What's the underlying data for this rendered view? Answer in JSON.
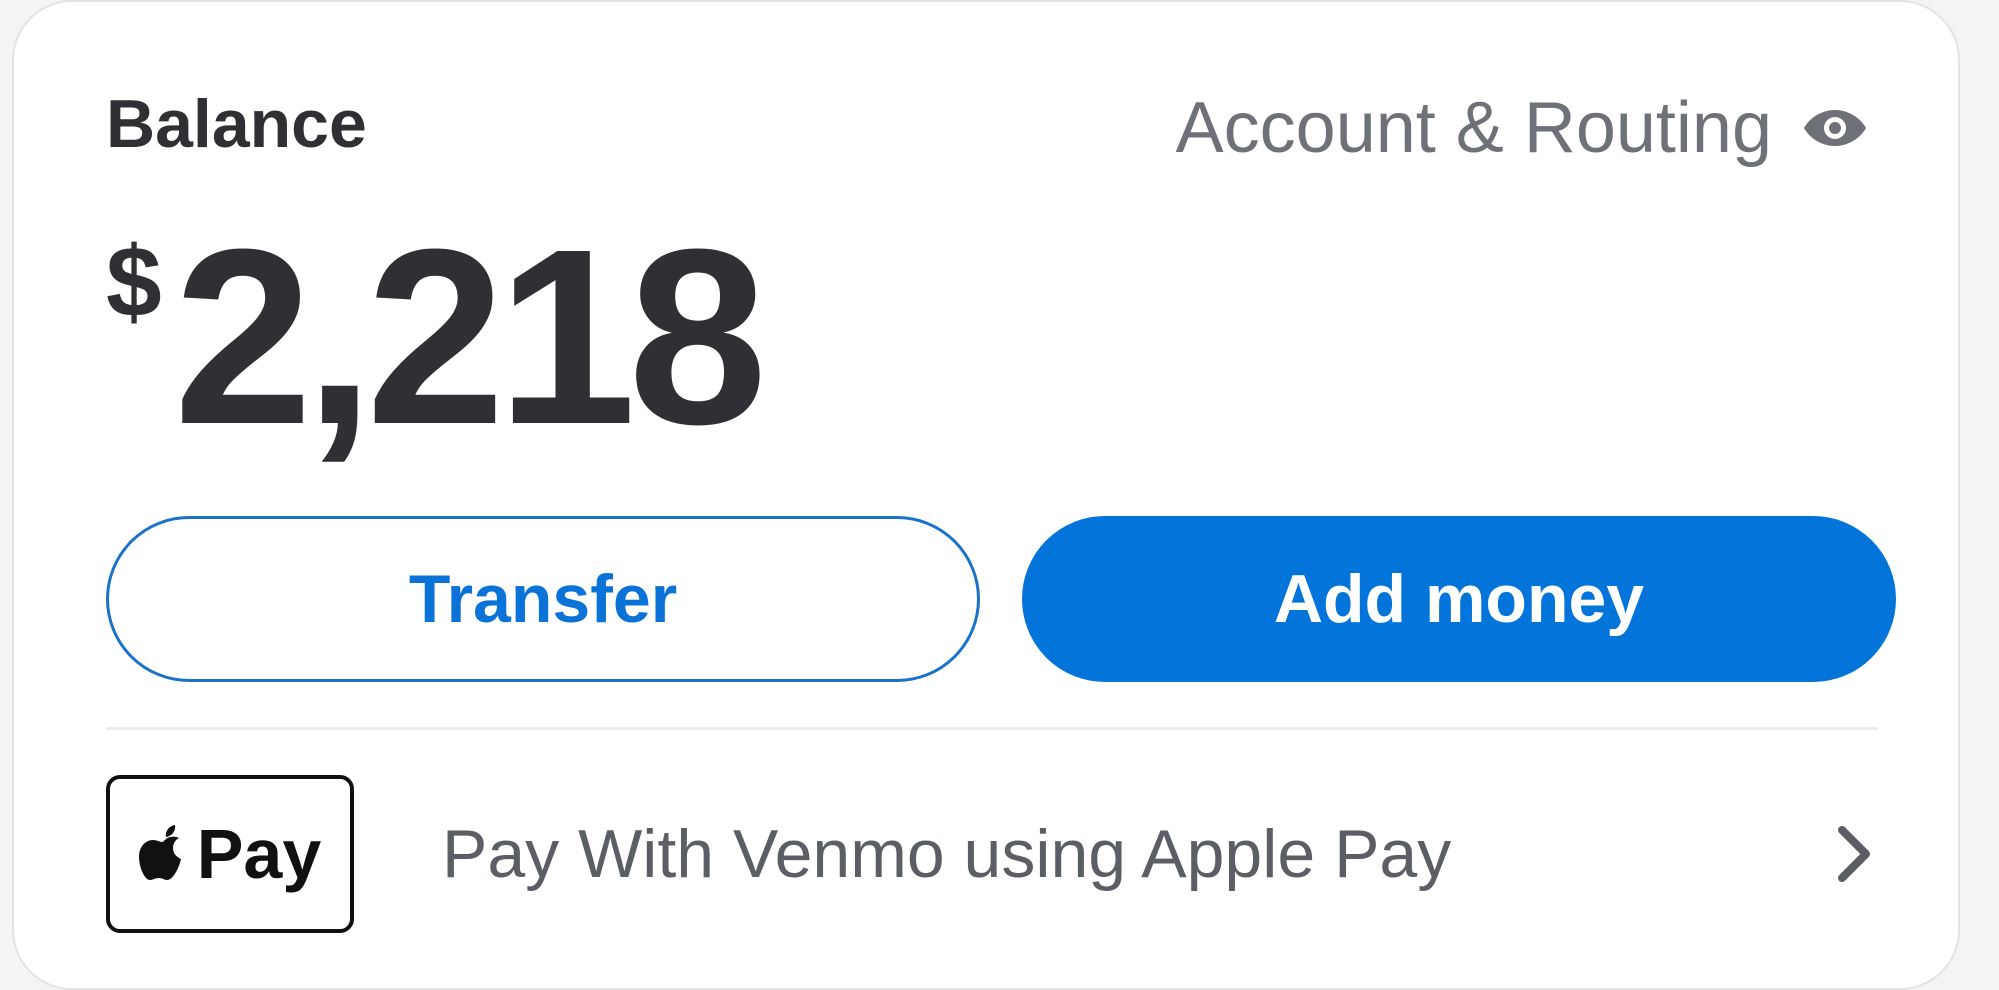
{
  "balance": {
    "label": "Balance",
    "currency_symbol": "$",
    "amount": "2,218"
  },
  "account_routing": {
    "label": "Account & Routing",
    "icon": "eye-icon"
  },
  "actions": {
    "transfer_label": "Transfer",
    "add_money_label": "Add money"
  },
  "apple_pay": {
    "badge_text": "Pay",
    "badge_icon": "apple-logo-icon",
    "label": "Pay With Venmo using Apple Pay",
    "chevron_icon": "chevron-right-icon"
  },
  "colors": {
    "accent": "#0374d9",
    "text_dark": "#2f3033",
    "text_muted": "#6f7178"
  }
}
